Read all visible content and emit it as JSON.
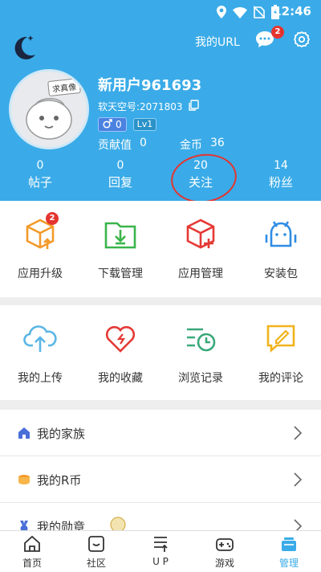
{
  "status_bar": {
    "time": "12:46"
  },
  "header": {
    "my_url": "我的URL",
    "message_badge": "2",
    "avatar_tag": "求真像",
    "username": "新用户961693",
    "rtid": "软天空号:2071803",
    "gender_count": "0",
    "level": "Lv1",
    "contribution_label": "贡献值",
    "contribution_value": "0",
    "gold_label": "金币",
    "gold_value": "36",
    "stats": [
      {
        "num": "0",
        "label": "帖子"
      },
      {
        "num": "0",
        "label": "回复"
      },
      {
        "num": "20",
        "label": "关注"
      },
      {
        "num": "14",
        "label": "粉丝"
      }
    ]
  },
  "grid1": [
    {
      "label": "应用升级",
      "icon": "app-upgrade-icon",
      "badge": "2"
    },
    {
      "label": "下载管理",
      "icon": "download-manage-icon"
    },
    {
      "label": "应用管理",
      "icon": "app-manage-icon"
    },
    {
      "label": "安装包",
      "icon": "install-package-icon"
    }
  ],
  "grid2": [
    {
      "label": "我的上传",
      "icon": "upload-icon"
    },
    {
      "label": "我的收藏",
      "icon": "favorite-icon"
    },
    {
      "label": "浏览记录",
      "icon": "history-icon"
    },
    {
      "label": "我的评论",
      "icon": "comment-icon"
    }
  ],
  "list": [
    {
      "label": "我的家族",
      "icon": "family-icon"
    },
    {
      "label": "我的R币",
      "icon": "rcoin-icon"
    },
    {
      "label": "我的勋章",
      "icon": "medal-icon"
    }
  ],
  "bottom_nav": [
    {
      "label": "首页",
      "icon": "home-icon"
    },
    {
      "label": "社区",
      "icon": "community-icon"
    },
    {
      "label": "U P",
      "icon": "up-icon"
    },
    {
      "label": "游戏",
      "icon": "game-icon"
    },
    {
      "label": "管理",
      "icon": "manage-icon",
      "active": true
    }
  ],
  "colors": {
    "primary": "#3aabe8",
    "badge": "#e5342f",
    "orange": "#f39a2b",
    "green": "#3ab54a",
    "red": "#e53935",
    "blue": "#2f8de4"
  }
}
